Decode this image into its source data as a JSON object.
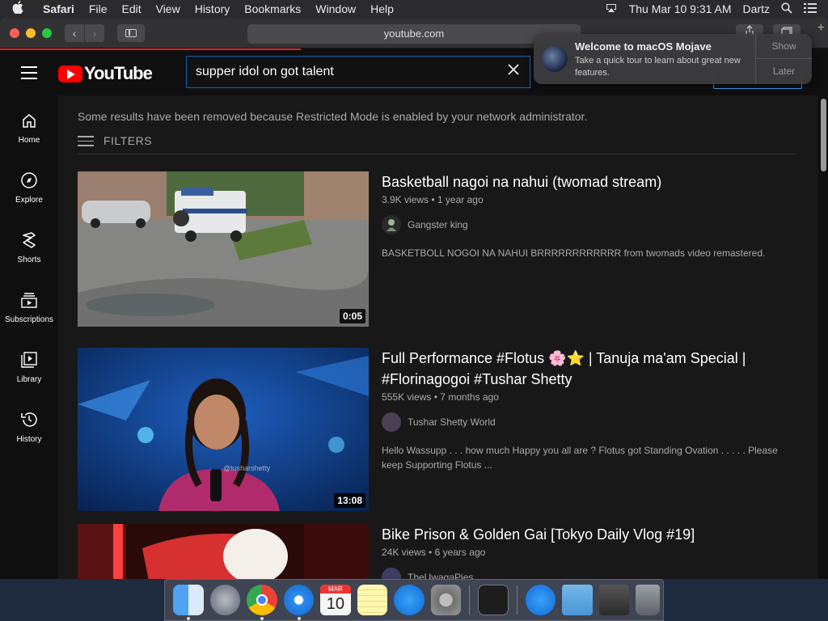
{
  "menubar": {
    "apple": "",
    "app": "Safari",
    "items": [
      "File",
      "Edit",
      "View",
      "History",
      "Bookmarks",
      "Window",
      "Help"
    ],
    "datetime": "Thu Mar 10  9:31 AM",
    "user": "Dartz"
  },
  "safari": {
    "url": "youtube.com",
    "back": "‹",
    "forward": "›"
  },
  "youtube": {
    "logo_text": "YouTube",
    "search_query": "supper idol on got talent",
    "nav": [
      {
        "label": "Home"
      },
      {
        "label": "Explore"
      },
      {
        "label": "Shorts"
      },
      {
        "label": "Subscriptions"
      },
      {
        "label": "Library"
      },
      {
        "label": "History"
      }
    ],
    "notice": "Some results have been removed because Restricted Mode is enabled by your network administrator.",
    "filters_label": "FILTERS",
    "results": [
      {
        "title": "Basketball nagoi na nahui (twomad stream)",
        "views": "3.9K views",
        "age": "1 year ago",
        "channel": "Gangster king",
        "description": "BASKETBOLL NOGOI NA NAHUI BRRRRRRRRRRRR from twomads video remastered.",
        "duration": "0:05"
      },
      {
        "title": "Full Performance #Flotus 🌸⭐ | Tanuja ma'am Special | #Florinagogoi #Tushar Shetty",
        "views": "555K views",
        "age": "7 months ago",
        "channel": "Tushar Shetty World",
        "description": "Hello Wassupp . . . how much Happy you all are ? Flotus got Standing Ovation . . . . . Please keep Supporting Flotus ...",
        "duration": "13:08",
        "watermark": "@tusharshetty"
      },
      {
        "title": "Bike Prison & Golden Gai [Tokyo Daily Vlog #19]",
        "views": "24K views",
        "age": "6 years ago",
        "channel": "TheUwagaPies"
      }
    ]
  },
  "notification": {
    "title": "Welcome to macOS Mojave",
    "body": "Take a quick tour to learn about great new features.",
    "show": "Show",
    "later": "Later"
  },
  "dock": {
    "calendar_month": "MAR",
    "calendar_day": "10"
  }
}
